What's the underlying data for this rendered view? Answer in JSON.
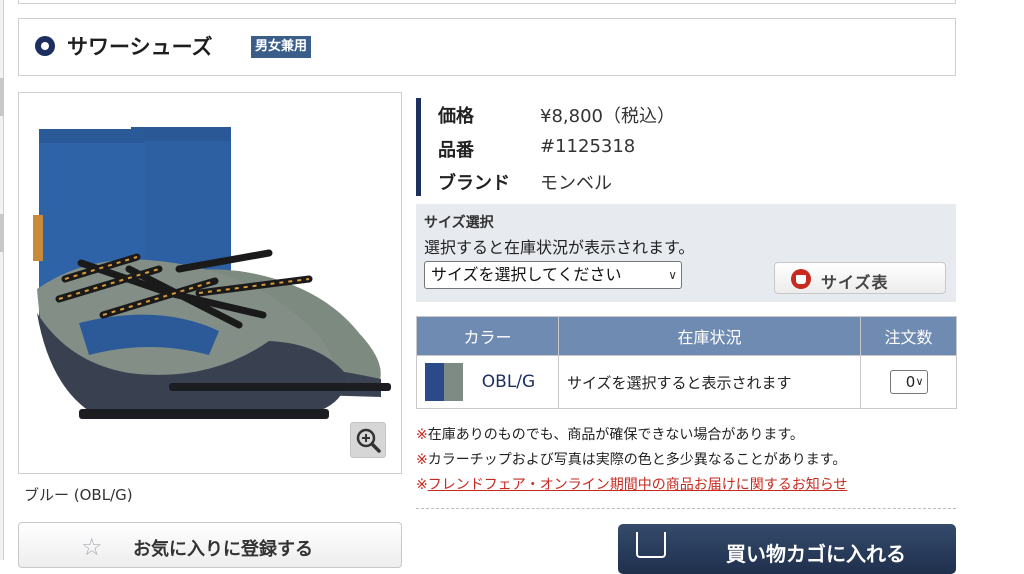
{
  "product": {
    "title": "サワーシューズ",
    "badge": "男女兼用",
    "image_caption": "ブルー (OBL/G)"
  },
  "info": [
    {
      "label": "価格",
      "value": "¥8,800（税込）"
    },
    {
      "label": "品番",
      "value": "#1125318"
    },
    {
      "label": "ブランド",
      "value": "モンベル"
    }
  ],
  "size_panel": {
    "heading": "サイズ選択",
    "note": "選択すると在庫状況が表示されます。",
    "select_value": "サイズを選択してください",
    "size_chart_label": "サイズ表"
  },
  "stock_table": {
    "headers": [
      "カラー",
      "在庫状況",
      "注文数"
    ],
    "rows": [
      {
        "color_code": "OBL/G",
        "chip_colors": [
          "#2b4a8a",
          "#7e8a84"
        ],
        "status": "サイズを選択すると表示されます",
        "qty": "0"
      }
    ]
  },
  "notices": [
    {
      "mark": "※",
      "text": "在庫ありのものでも、商品が確保できない場合があります。"
    },
    {
      "mark": "※",
      "text": "カラーチップおよび写真は実際の色と多少異なることがあります。"
    },
    {
      "mark": "※",
      "text": "フレンドフェア・オンライン期間中の商品お届けに関するお知らせ"
    }
  ],
  "buttons": {
    "favorite": "お気に入りに登録する",
    "cart": "買い物カゴに入れる"
  },
  "icons": {
    "title": "circle-bullet-icon",
    "zoom": "magnifier-plus-icon",
    "favorite": "star-outline-icon",
    "size_chart": "shirt-icon",
    "cart": "shopping-bag-icon"
  },
  "colors": {
    "navy": "#1c2f5e",
    "table_header": "#6f8bb1",
    "notice_red": "#c72a1f",
    "panel_bg": "#e7eaef"
  }
}
